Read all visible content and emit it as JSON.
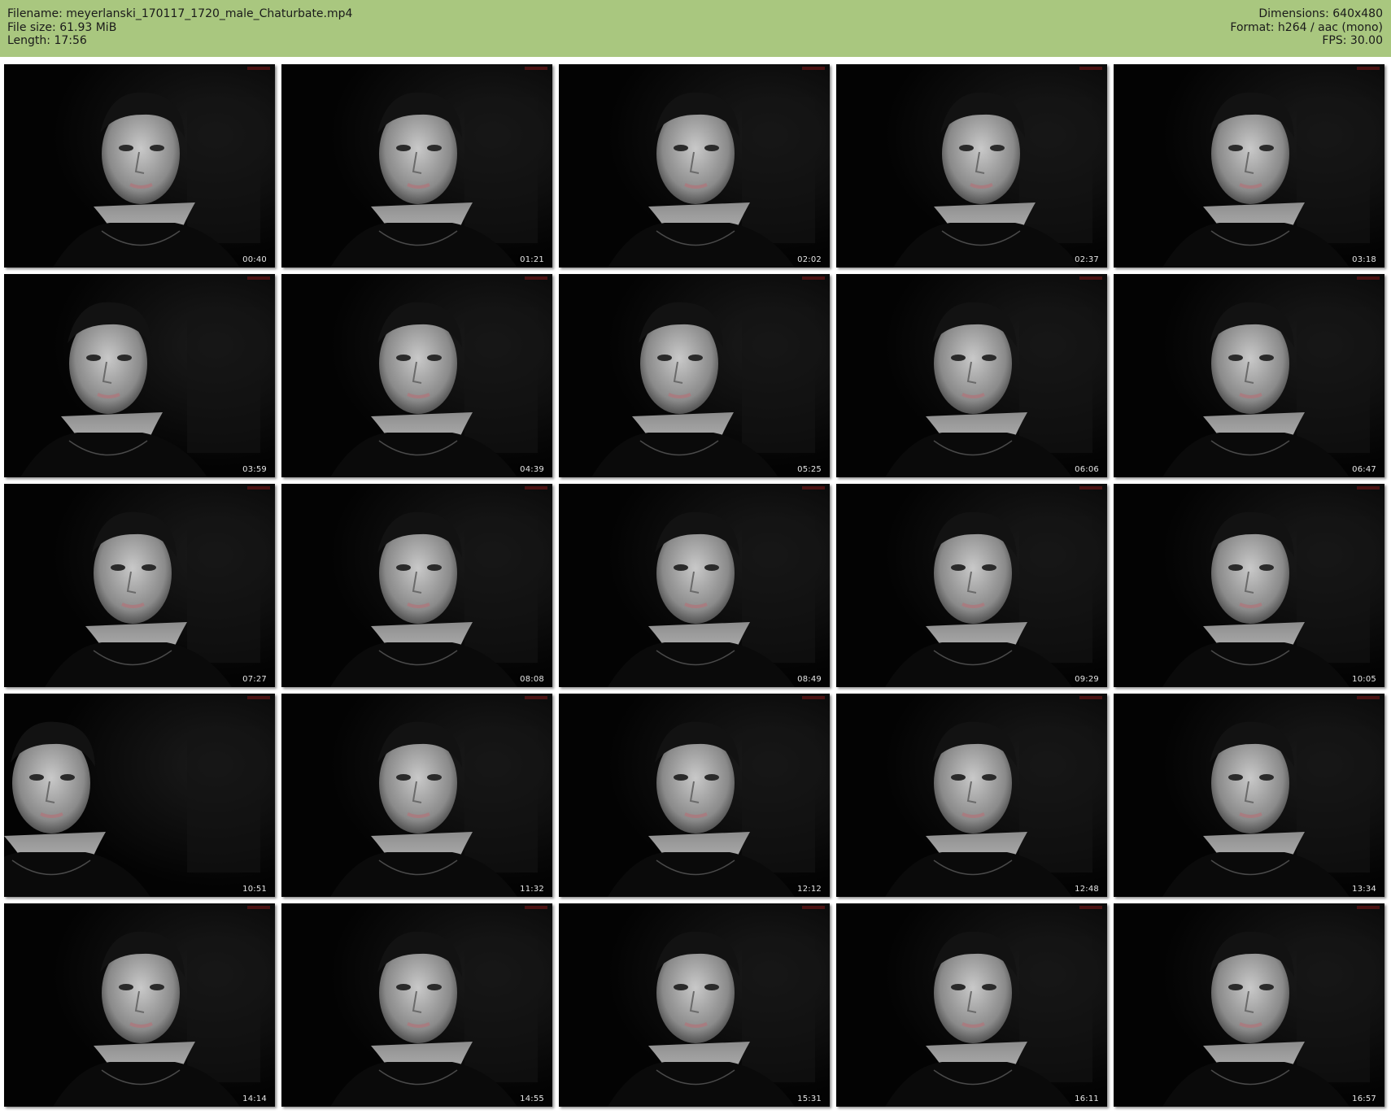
{
  "header": {
    "filename": "Filename: meyerlanski_170117_1720_male_Chaturbate.mp4",
    "filesize": "File size: 61.93 MiB",
    "length": "Length: 17:56",
    "dimensions": "Dimensions: 640x480",
    "format": "Format: h264 / aac (mono)",
    "fps": "FPS: 30.00",
    "background_color": "#a9c77f"
  },
  "thumbnails": [
    {
      "timestamp": "00:40"
    },
    {
      "timestamp": "01:21"
    },
    {
      "timestamp": "02:02"
    },
    {
      "timestamp": "02:37"
    },
    {
      "timestamp": "03:18"
    },
    {
      "timestamp": "03:59"
    },
    {
      "timestamp": "04:39"
    },
    {
      "timestamp": "05:25"
    },
    {
      "timestamp": "06:06"
    },
    {
      "timestamp": "06:47"
    },
    {
      "timestamp": "07:27"
    },
    {
      "timestamp": "08:08"
    },
    {
      "timestamp": "08:49"
    },
    {
      "timestamp": "09:29"
    },
    {
      "timestamp": "10:05"
    },
    {
      "timestamp": "10:51"
    },
    {
      "timestamp": "11:32"
    },
    {
      "timestamp": "12:12"
    },
    {
      "timestamp": "12:48"
    },
    {
      "timestamp": "13:34"
    },
    {
      "timestamp": "14:14"
    },
    {
      "timestamp": "14:55"
    },
    {
      "timestamp": "15:31"
    },
    {
      "timestamp": "16:11"
    },
    {
      "timestamp": "16:57"
    }
  ]
}
